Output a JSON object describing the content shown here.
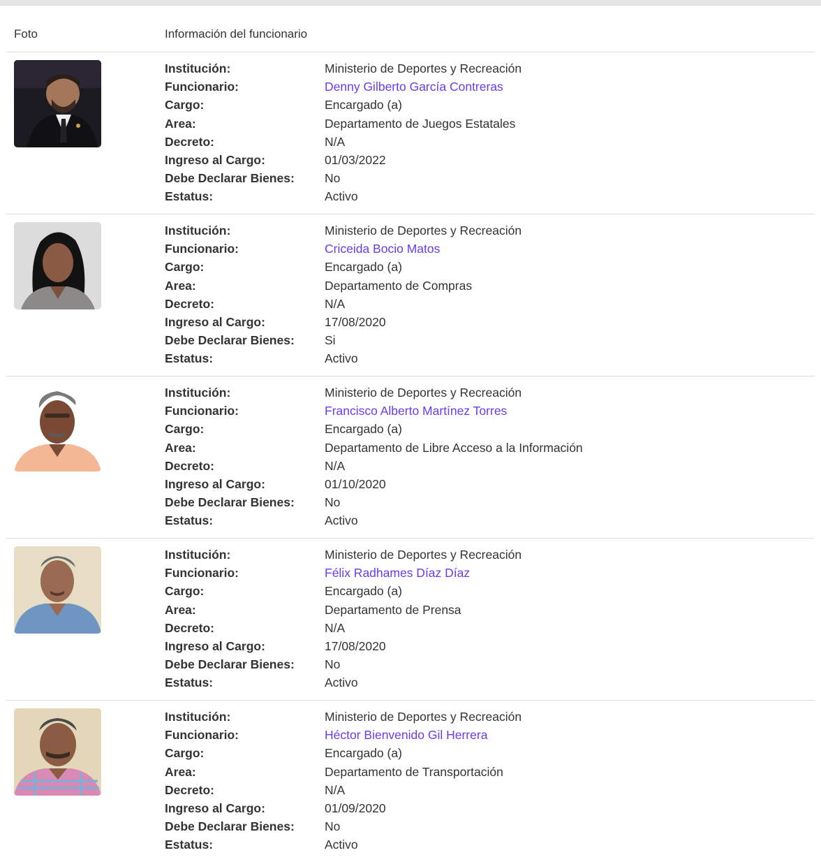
{
  "header": {
    "foto": "Foto",
    "info": "Información del funcionario"
  },
  "labels": {
    "institucion": "Institución:",
    "funcionario": "Funcionario:",
    "cargo": "Cargo:",
    "area": "Area:",
    "decreto": "Decreto:",
    "ingreso": "Ingreso al Cargo:",
    "declarar": "Debe Declarar Bienes:",
    "estatus": "Estatus:"
  },
  "officials": [
    {
      "institucion": "Ministerio de Deportes y Recreación",
      "funcionario": "Denny Gilberto García Contreras",
      "cargo": "Encargado (a)",
      "area": "Departamento de Juegos Estatales",
      "decreto": "N/A",
      "ingreso": "01/03/2022",
      "declarar": "No",
      "estatus": "Activo"
    },
    {
      "institucion": "Ministerio de Deportes y Recreación",
      "funcionario": "Criceida Bocio Matos",
      "cargo": "Encargado (a)",
      "area": "Departamento de Compras",
      "decreto": "N/A",
      "ingreso": "17/08/2020",
      "declarar": "Si",
      "estatus": "Activo"
    },
    {
      "institucion": "Ministerio de Deportes y Recreación",
      "funcionario": "Francisco Alberto Martínez Torres",
      "cargo": "Encargado (a)",
      "area": "Departamento de Libre Acceso a la Información",
      "decreto": "N/A",
      "ingreso": "01/10/2020",
      "declarar": "No",
      "estatus": "Activo"
    },
    {
      "institucion": "Ministerio de Deportes y Recreación",
      "funcionario": "Félix Radhames Díaz Díaz",
      "cargo": "Encargado (a)",
      "area": "Departamento de Prensa",
      "decreto": "N/A",
      "ingreso": "17/08/2020",
      "declarar": "No",
      "estatus": "Activo"
    },
    {
      "institucion": "Ministerio de Deportes y Recreación",
      "funcionario": "Héctor Bienvenido Gil Herrera",
      "cargo": "Encargado (a)",
      "area": "Departamento de Transportación",
      "decreto": "N/A",
      "ingreso": "01/09/2020",
      "declarar": "No",
      "estatus": "Activo"
    }
  ],
  "colors": {
    "link": "#6a3cf0",
    "text": "#333333",
    "divider": "#dddddd"
  }
}
